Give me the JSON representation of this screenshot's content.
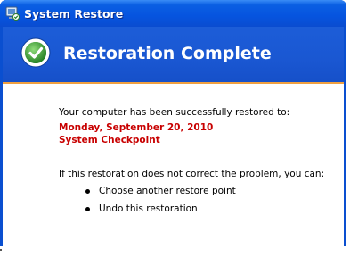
{
  "window": {
    "title": "System Restore",
    "icon": "system-restore-icon"
  },
  "header": {
    "title": "Restoration Complete",
    "icon": "success-check-icon"
  },
  "content": {
    "intro": "Your computer has been successfully restored to:",
    "restore_date": "Monday, September 20, 2010",
    "restore_point_name": "System Checkpoint",
    "followup": "If this restoration does not correct the problem, you can:",
    "options": [
      "Choose another restore point",
      "Undo this restoration"
    ]
  },
  "colors": {
    "header_bg": "#1a57d2",
    "accent_rule": "#f0a040",
    "highlight_text": "#c80000"
  }
}
